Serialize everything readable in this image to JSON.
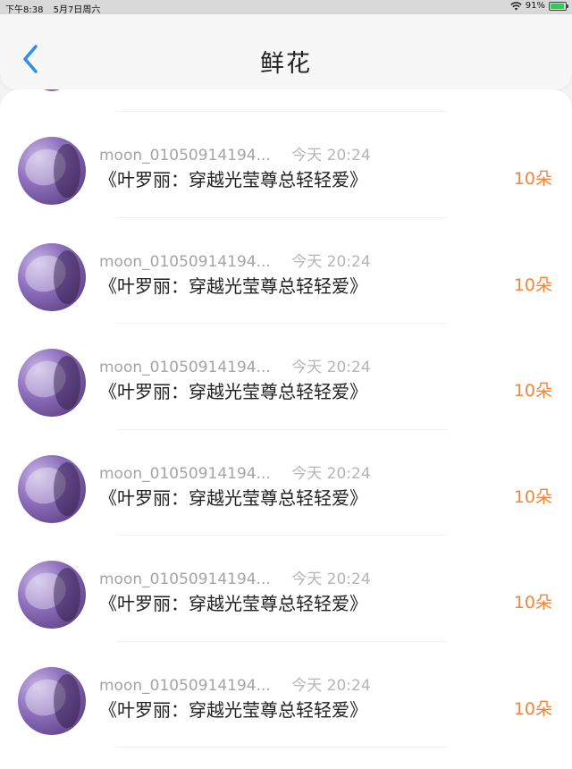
{
  "status_bar": {
    "time": "下午8:38",
    "date": "5月7日周六",
    "battery": "91%",
    "battery_level": 0.91
  },
  "header": {
    "title": "鲜花",
    "back_icon": "chevron-left-icon"
  },
  "colors": {
    "accent_blue": "#2f8fe8",
    "count_orange": "#f0853c",
    "battery_green": "#36c759"
  },
  "items": [
    {
      "username": "moon_01050914194...",
      "time": "今天 20:24",
      "book": "《叶罗丽：穿越光莹尊总轻轻爱》",
      "count": "10朵"
    },
    {
      "username": "moon_01050914194...",
      "time": "今天 20:24",
      "book": "《叶罗丽：穿越光莹尊总轻轻爱》",
      "count": "10朵"
    },
    {
      "username": "moon_01050914194...",
      "time": "今天 20:24",
      "book": "《叶罗丽：穿越光莹尊总轻轻爱》",
      "count": "10朵"
    },
    {
      "username": "moon_01050914194...",
      "time": "今天 20:24",
      "book": "《叶罗丽：穿越光莹尊总轻轻爱》",
      "count": "10朵"
    },
    {
      "username": "moon_01050914194...",
      "time": "今天 20:24",
      "book": "《叶罗丽：穿越光莹尊总轻轻爱》",
      "count": "10朵"
    },
    {
      "username": "moon_01050914194...",
      "time": "今天 20:24",
      "book": "《叶罗丽：穿越光莹尊总轻轻爱》",
      "count": "10朵"
    }
  ]
}
